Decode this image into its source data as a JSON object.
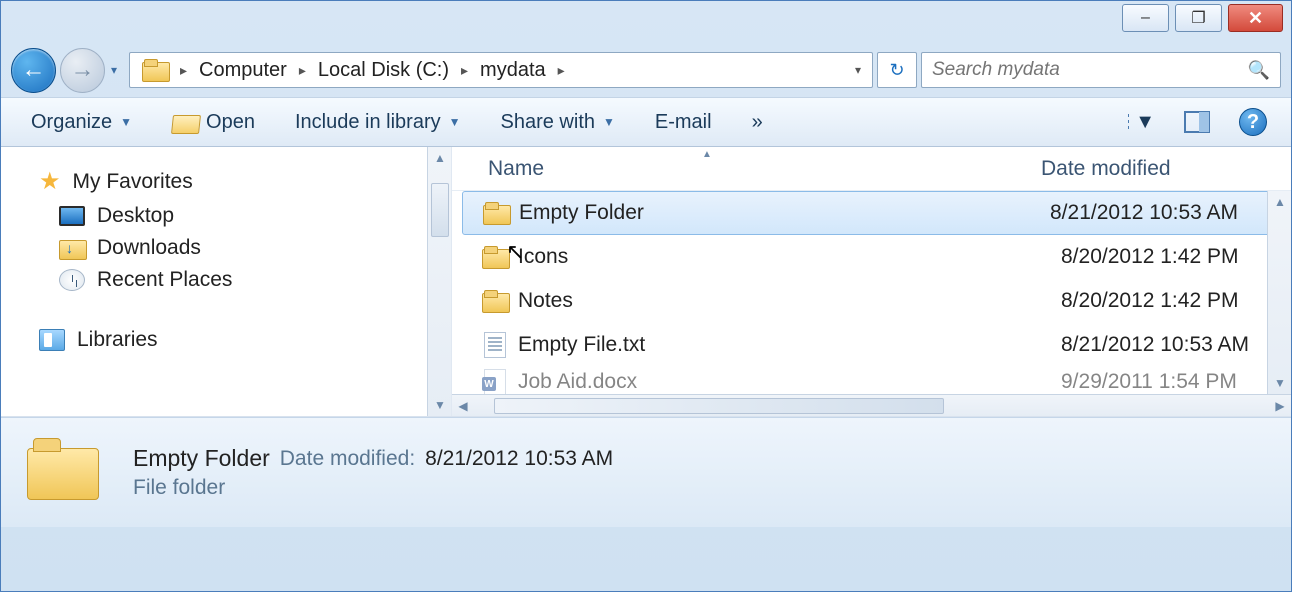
{
  "window_controls": {
    "minimize": "–",
    "maximize": "❐",
    "close": "✕"
  },
  "breadcrumb": {
    "items": [
      "Computer",
      "Local Disk (C:)",
      "mydata"
    ]
  },
  "search": {
    "placeholder": "Search mydata"
  },
  "toolbar": {
    "organize": "Organize",
    "open": "Open",
    "include": "Include in library",
    "share": "Share with",
    "email": "E-mail",
    "more": "»"
  },
  "navpane": {
    "favorites": "My Favorites",
    "desktop": "Desktop",
    "downloads": "Downloads",
    "recent": "Recent Places",
    "libraries": "Libraries"
  },
  "columns": {
    "name": "Name",
    "date": "Date modified"
  },
  "files": [
    {
      "name": "Empty Folder",
      "date": "8/21/2012 10:53 AM",
      "type": "folder",
      "selected": true
    },
    {
      "name": "Icons",
      "date": "8/20/2012 1:42 PM",
      "type": "folder",
      "selected": false
    },
    {
      "name": "Notes",
      "date": "8/20/2012 1:42 PM",
      "type": "folder",
      "selected": false
    },
    {
      "name": "Empty File.txt",
      "date": "8/21/2012 10:53 AM",
      "type": "txt",
      "selected": false
    },
    {
      "name": "Job Aid.docx",
      "date": "9/29/2011 1:54 PM",
      "type": "docx",
      "selected": false
    }
  ],
  "details": {
    "title": "Empty Folder",
    "date_label": "Date modified:",
    "date_value": "8/21/2012 10:53 AM",
    "type": "File folder"
  }
}
